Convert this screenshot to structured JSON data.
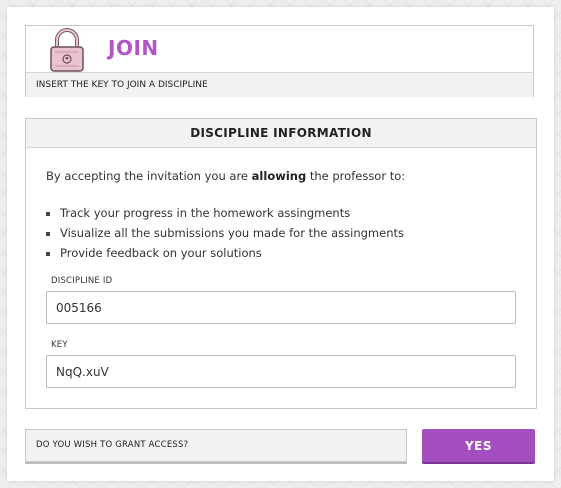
{
  "header": {
    "title": "JOIN",
    "subtitle": "INSERT THE KEY TO JOIN A DISCIPLINE",
    "icon": "padlock-icon"
  },
  "info": {
    "title": "DISCIPLINE INFORMATION",
    "intro_before": "By accepting the invitation you are ",
    "intro_bold": "allowing",
    "intro_after": " the professor to:",
    "permissions": [
      "Track your progress in the homework assingments",
      "Visualize all the submissions you made for the assingments",
      "Provide feedback on your solutions"
    ]
  },
  "fields": {
    "discipline_id": {
      "label": "DISCIPLINE ID",
      "value": "005166"
    },
    "key": {
      "label": "KEY",
      "value": "NqQ.xuV"
    }
  },
  "footer": {
    "grant_prompt": "DO YOU WISH TO GRANT ACCESS?",
    "yes_label": "YES"
  },
  "colors": {
    "accent": "#a34fc0",
    "title": "#b056c8"
  }
}
